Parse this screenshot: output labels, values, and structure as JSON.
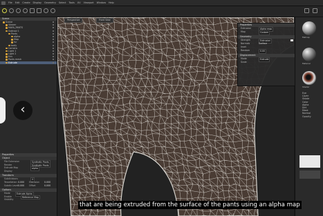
{
  "menubar": {
    "items": [
      "File",
      "Edit",
      "Create",
      "Display",
      "Geometry",
      "Select",
      "Tools",
      "UV",
      "Viewport",
      "Window",
      "Help"
    ]
  },
  "toolbar": {
    "tools": [
      "select-tool",
      "move-tool",
      "rotate-tool",
      "scale-tool",
      "brush-tool",
      "lasso-tool",
      "paint-tool",
      "mask-tool",
      "view-tool"
    ]
  },
  "left_panel": {
    "header": "Scene",
    "tree": [
      {
        "label": "Scene",
        "indent": 0
      },
      {
        "label": "Viewer",
        "indent": 1
      },
      {
        "label": "MAYA_PANTS",
        "indent": 1
      },
      {
        "label": "Subtool 1",
        "indent": 1
      },
      {
        "label": "Pants",
        "indent": 2
      },
      {
        "label": "alpha",
        "indent": 3
      },
      {
        "label": "Map",
        "indent": 3
      },
      {
        "label": "fur",
        "indent": 3
      },
      {
        "label": "body",
        "indent": 2
      },
      {
        "label": "Camera",
        "indent": 1
      },
      {
        "label": "Light 1",
        "indent": 1
      },
      {
        "label": "Light 2",
        "indent": 1
      },
      {
        "label": "Env",
        "indent": 1
      },
      {
        "label": "Pants mesh",
        "indent": 1
      },
      {
        "label": "Extrude",
        "indent": 1
      }
    ],
    "selected_index": 14,
    "properties_header": "Properties",
    "object_header": "Object",
    "props": [
      {
        "k": "File Extension",
        "v": "Synthetic Pants"
      },
      {
        "k": "Render",
        "v": "Synthetic Pants"
      },
      {
        "k": "Extrude Map",
        "v": "alpha"
      },
      {
        "k": "Display",
        "v": ""
      }
    ],
    "transform_header": "Transform",
    "transform": [
      {
        "k": "Subdivisions",
        "v": "4"
      },
      {
        "k": "Tessellation",
        "v": "0.000",
        "k2": "Extrusion",
        "v2": "0.000"
      },
      {
        "k": "Subdiv Level",
        "v": "0.000",
        "k2": "Offset",
        "v2": "0.000"
      }
    ],
    "footer_header": "Options",
    "footer": [
      {
        "k": "Mode",
        "v": "Extrude Alpha"
      },
      {
        "k": "Enable",
        "v": "Reference Map"
      },
      {
        "k": "Visibility",
        "v": ""
      }
    ]
  },
  "viewport": {
    "tabs": [
      "Perspective",
      "Front View"
    ]
  },
  "float_panel": {
    "title": "Properties",
    "rows": [
      {
        "k": "Extrusion",
        "v": "Alpha map"
      },
      {
        "k": "Map",
        "v": "Custom"
      }
    ],
    "section1": "Geometry",
    "rows2": [
      {
        "k": "Strength",
        "v": "Extrusion"
      },
      {
        "k": "Normals",
        "v": "Surface"
      },
      {
        "k": "Inset",
        "v": ""
      },
      {
        "k": "Random",
        "v": "0.00"
      }
    ],
    "section2": "Displacement",
    "rows3": [
      {
        "k": "Mode",
        "v": "Extrude"
      },
      {
        "k": "Scale",
        "v": ""
      }
    ]
  },
  "right_panel": {
    "labels": [
      "Matcap",
      "Material",
      "Shader",
      "Eye",
      "Layer",
      "Shade",
      "Color",
      "Alpha",
      "Dirt",
      "Mask",
      "Normal",
      "Opacity"
    ]
  },
  "subtitle": "that are being extruded from the surface of the pants using an alpha map",
  "colors": {
    "mesh_skin": "#4a3c34",
    "wire": "#d9d6d0",
    "background": "#1b1b1b",
    "selection": "#4d5e78"
  }
}
